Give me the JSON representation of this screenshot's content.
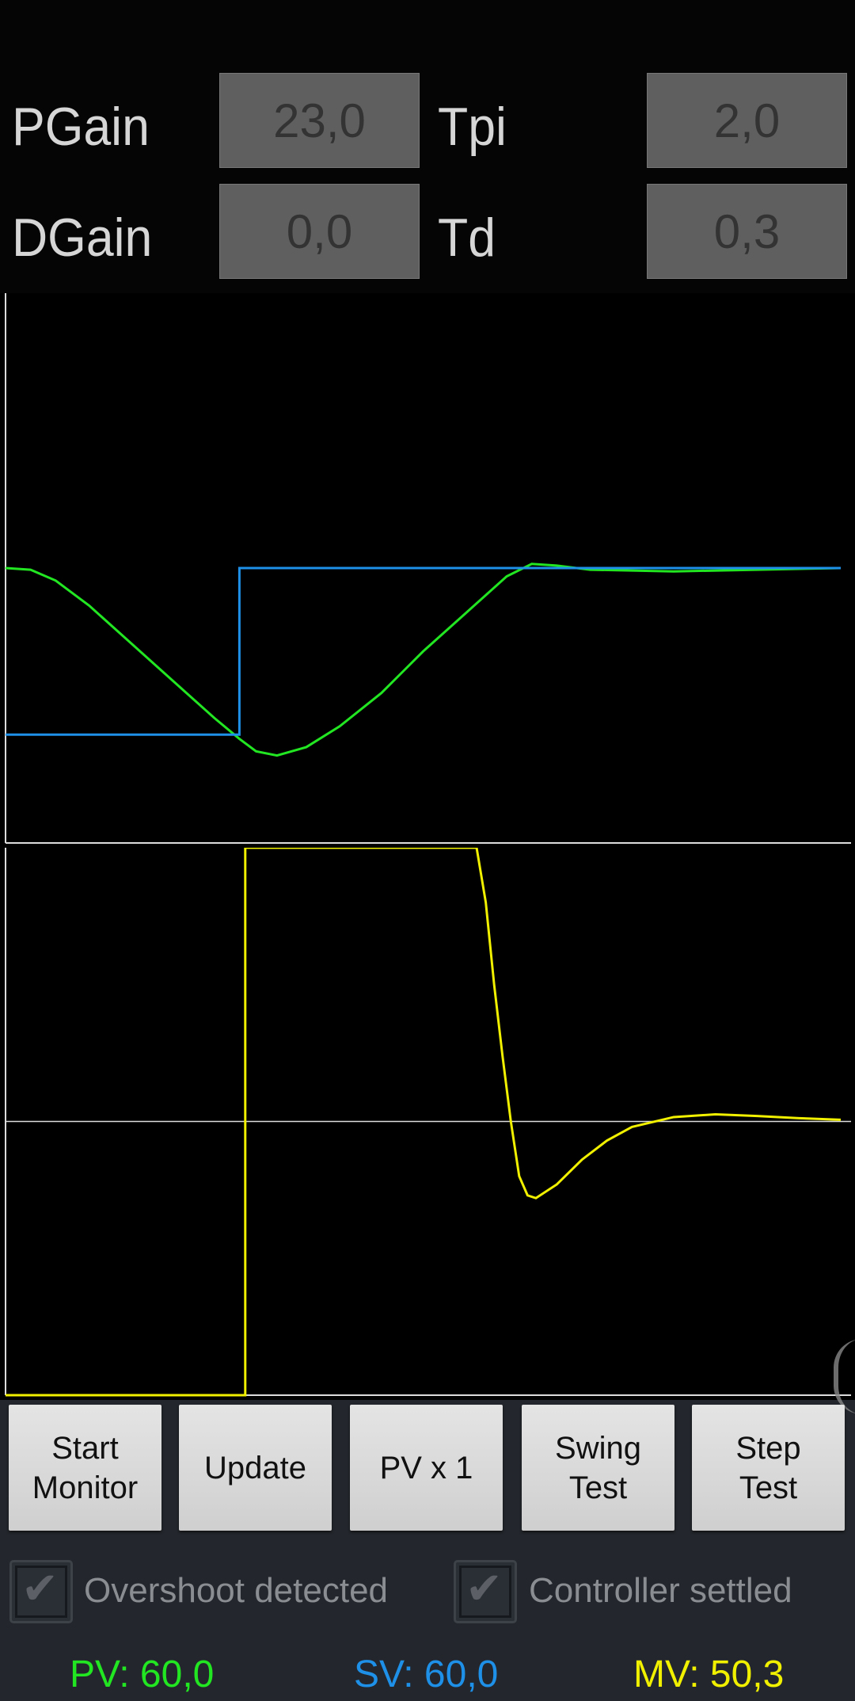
{
  "params": {
    "pgain": {
      "label": "PGain",
      "value": "23,0"
    },
    "tpi": {
      "label": "Tpi",
      "value": "2,0"
    },
    "dgain": {
      "label": "DGain",
      "value": "0,0"
    },
    "td": {
      "label": "Td",
      "value": "0,3"
    }
  },
  "chart_data": [
    {
      "type": "line",
      "xlim": [
        0,
        100
      ],
      "ylim": [
        27,
        93
      ],
      "grid": false,
      "series": [
        {
          "color": "#22e622",
          "points": [
            [
              0,
              60
            ],
            [
              3,
              59.8
            ],
            [
              6,
              58.5
            ],
            [
              10,
              55.5
            ],
            [
              15,
              51
            ],
            [
              20,
              46.5
            ],
            [
              25,
              42
            ],
            [
              28,
              39.5
            ],
            [
              30,
              38
            ],
            [
              32.5,
              37.5
            ],
            [
              36,
              38.5
            ],
            [
              40,
              41
            ],
            [
              45,
              45
            ],
            [
              50,
              50
            ],
            [
              55,
              54.5
            ],
            [
              60,
              59
            ],
            [
              63,
              60.5
            ],
            [
              66,
              60.3
            ],
            [
              70,
              59.8
            ],
            [
              80,
              59.6
            ],
            [
              90,
              59.8
            ],
            [
              100,
              60
            ]
          ]
        },
        {
          "color": "#1e90e8",
          "points": [
            [
              0,
              40
            ],
            [
              28,
              40
            ],
            [
              28,
              60
            ],
            [
              100,
              60
            ]
          ]
        }
      ]
    },
    {
      "type": "line",
      "xlim": [
        0,
        100
      ],
      "ylim": [
        0,
        100
      ],
      "grid": false,
      "reference_line": 50,
      "series": [
        {
          "color": "#f0f000",
          "points": [
            [
              0,
              0
            ],
            [
              28.7,
              0
            ],
            [
              28.7,
              100
            ],
            [
              56.4,
              100
            ],
            [
              57.5,
              90
            ],
            [
              58.5,
              75
            ],
            [
              59.5,
              62
            ],
            [
              60.5,
              50
            ],
            [
              61.5,
              40
            ],
            [
              62.5,
              36.5
            ],
            [
              63.5,
              36
            ],
            [
              66,
              38.5
            ],
            [
              69,
              43
            ],
            [
              72,
              46.5
            ],
            [
              75,
              49
            ],
            [
              80,
              50.8
            ],
            [
              85,
              51.3
            ],
            [
              90,
              51
            ],
            [
              95,
              50.6
            ],
            [
              100,
              50.3
            ]
          ]
        }
      ]
    }
  ],
  "buttons": [
    "Start\nMonitor",
    "Update",
    "PV x 1",
    "Swing\nTest",
    "Step\nTest"
  ],
  "checkboxes": [
    {
      "label": "Overshoot detected",
      "checked": true
    },
    {
      "label": "Controller settled",
      "checked": true
    }
  ],
  "readouts": {
    "pv": {
      "text": "PV: 60,0",
      "color": "#22e622"
    },
    "sv": {
      "text": "SV: 60,0",
      "color": "#1e90e8"
    },
    "mv": {
      "text": "MV: 50,3",
      "color": "#f0f000"
    }
  },
  "icons": {
    "check": "✔"
  }
}
